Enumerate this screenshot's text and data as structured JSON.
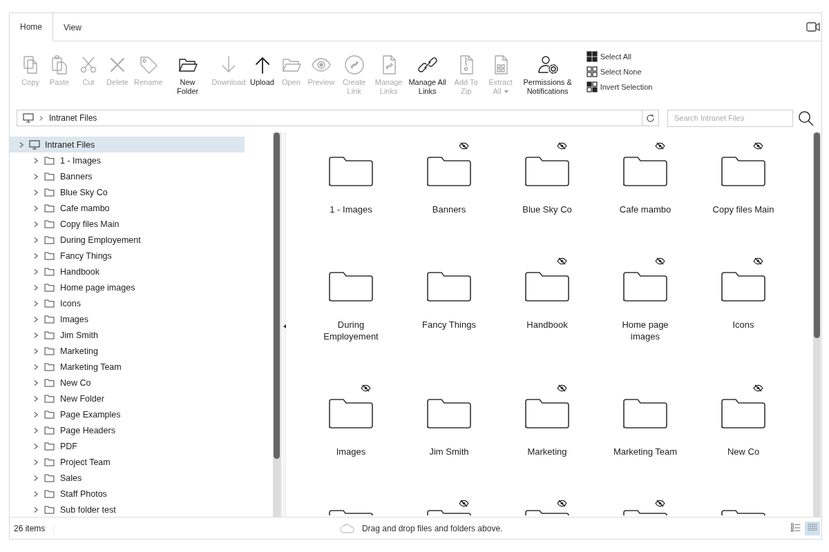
{
  "tabs": [
    {
      "label": "Home",
      "selected": true
    },
    {
      "label": "View",
      "selected": false
    }
  ],
  "toolbar": [
    {
      "kind": "copy",
      "label": "Copy",
      "disabled": true
    },
    {
      "kind": "paste",
      "label": "Paste",
      "disabled": true
    },
    {
      "kind": "cut",
      "label": "Cut",
      "disabled": true
    },
    {
      "kind": "delete",
      "label": "Delete",
      "disabled": true
    },
    {
      "kind": "rename",
      "label": "Rename",
      "disabled": true
    },
    {
      "kind": "new-folder",
      "label": "New Folder",
      "disabled": false
    },
    {
      "kind": "download",
      "label": "Download",
      "disabled": true
    },
    {
      "kind": "upload",
      "label": "Upload",
      "disabled": false
    },
    {
      "kind": "open",
      "label": "Open",
      "disabled": true
    },
    {
      "kind": "preview",
      "label": "Preview",
      "disabled": true
    },
    {
      "kind": "create-link",
      "label": "Create Link",
      "disabled": true
    },
    {
      "kind": "manage-links",
      "label": "Manage Links",
      "disabled": true
    },
    {
      "kind": "manage-all-links",
      "label": "Manage All Links",
      "disabled": false
    },
    {
      "kind": "zip",
      "label": "Add To Zip",
      "disabled": true
    },
    {
      "kind": "extract",
      "label": "Extract All",
      "disabled": true,
      "dropdown": true
    },
    {
      "kind": "permissions",
      "label": "Permissions & Notifications",
      "disabled": false
    }
  ],
  "selection_actions": [
    {
      "kind": "select-all",
      "label": "Select All"
    },
    {
      "kind": "select-none",
      "label": "Select None"
    },
    {
      "kind": "invert",
      "label": "Invert Selection"
    }
  ],
  "path": {
    "crumbs": [
      "Intranet Files"
    ]
  },
  "search": {
    "placeholder": "Search Intranet Files"
  },
  "tree": {
    "label": "Intranet Files",
    "selected": true,
    "children": [
      {
        "label": "1 - Images",
        "selected": false
      },
      {
        "label": "Banners",
        "selected": false
      },
      {
        "label": "Blue Sky Co",
        "selected": false
      },
      {
        "label": "Cafe mambo",
        "selected": false
      },
      {
        "label": "Copy files Main",
        "selected": false
      },
      {
        "label": "During Employement",
        "selected": false
      },
      {
        "label": "Fancy Things",
        "selected": false
      },
      {
        "label": "Handbook",
        "selected": false
      },
      {
        "label": "Home page images",
        "selected": false
      },
      {
        "label": "Icons",
        "selected": false
      },
      {
        "label": "Images",
        "selected": false
      },
      {
        "label": "Jim Smith",
        "selected": false
      },
      {
        "label": "Marketing",
        "selected": false
      },
      {
        "label": "Marketing Team",
        "selected": false
      },
      {
        "label": "New Co",
        "selected": false
      },
      {
        "label": "New Folder",
        "selected": false
      },
      {
        "label": "Page Examples",
        "selected": false
      },
      {
        "label": "Page Headers",
        "selected": false
      },
      {
        "label": "PDF",
        "selected": false
      },
      {
        "label": "Project Team",
        "selected": false
      },
      {
        "label": "Sales",
        "selected": false
      },
      {
        "label": "Staff Photos",
        "selected": false
      },
      {
        "label": "Sub folder test",
        "selected": false
      }
    ]
  },
  "folders": [
    {
      "name": "1 - Images",
      "hidden": false
    },
    {
      "name": "Banners",
      "hidden": true
    },
    {
      "name": "Blue Sky Co",
      "hidden": true
    },
    {
      "name": "Cafe mambo",
      "hidden": true
    },
    {
      "name": "Copy files Main",
      "hidden": true
    },
    {
      "name": "During Employement",
      "hidden": false
    },
    {
      "name": "Fancy Things",
      "hidden": false
    },
    {
      "name": "Handbook",
      "hidden": true
    },
    {
      "name": "Home page images",
      "hidden": true
    },
    {
      "name": "Icons",
      "hidden": true
    },
    {
      "name": "Images",
      "hidden": true
    },
    {
      "name": "Jim Smith",
      "hidden": false
    },
    {
      "name": "Marketing",
      "hidden": true
    },
    {
      "name": "Marketing Team",
      "hidden": false
    },
    {
      "name": "New Co",
      "hidden": true
    },
    {
      "hidden": false
    },
    {
      "hidden": true
    },
    {
      "hidden": true
    },
    {
      "hidden": true
    },
    {
      "hidden": false
    }
  ],
  "status_bar": {
    "count": "26 items",
    "drop_hint": "Drag and drop files and folders above.",
    "views": [
      {
        "kind": "list",
        "selected": false
      },
      {
        "kind": "grid",
        "selected": true
      }
    ]
  }
}
